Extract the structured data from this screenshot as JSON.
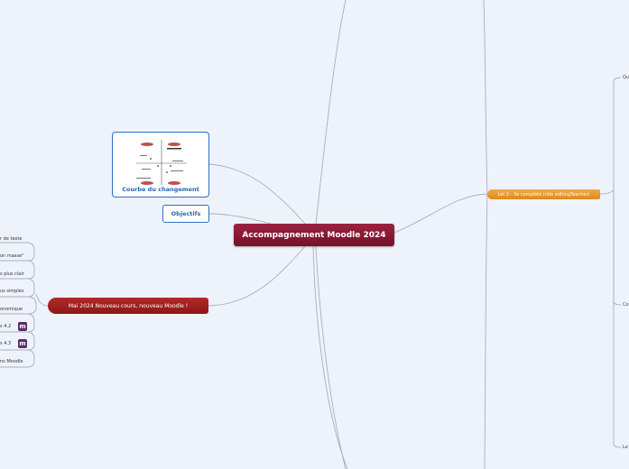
{
  "central": {
    "label": "Accompagnement Moodle 2024"
  },
  "change_curve": {
    "caption": "Courbe du changement"
  },
  "objectives": {
    "label": "Objectifs"
  },
  "mai": {
    "label": "Mai 2024 Nouveau cours, nouveau Moodle !"
  },
  "left_leaves": [
    "r de texte",
    "on masse\"",
    "s plus clair",
    "us simples",
    "onomique",
    "s 4.2",
    "s 4.3",
    "ns Moodle"
  ],
  "lot": {
    "label": "Lot 2 - 3e complété (rôle editingTeacher)"
  },
  "right_leaves": [
    "Qu",
    "Co",
    "Le"
  ],
  "icons": {
    "moodle_icon": "m",
    "icon_color": "#5b2a6e"
  }
}
